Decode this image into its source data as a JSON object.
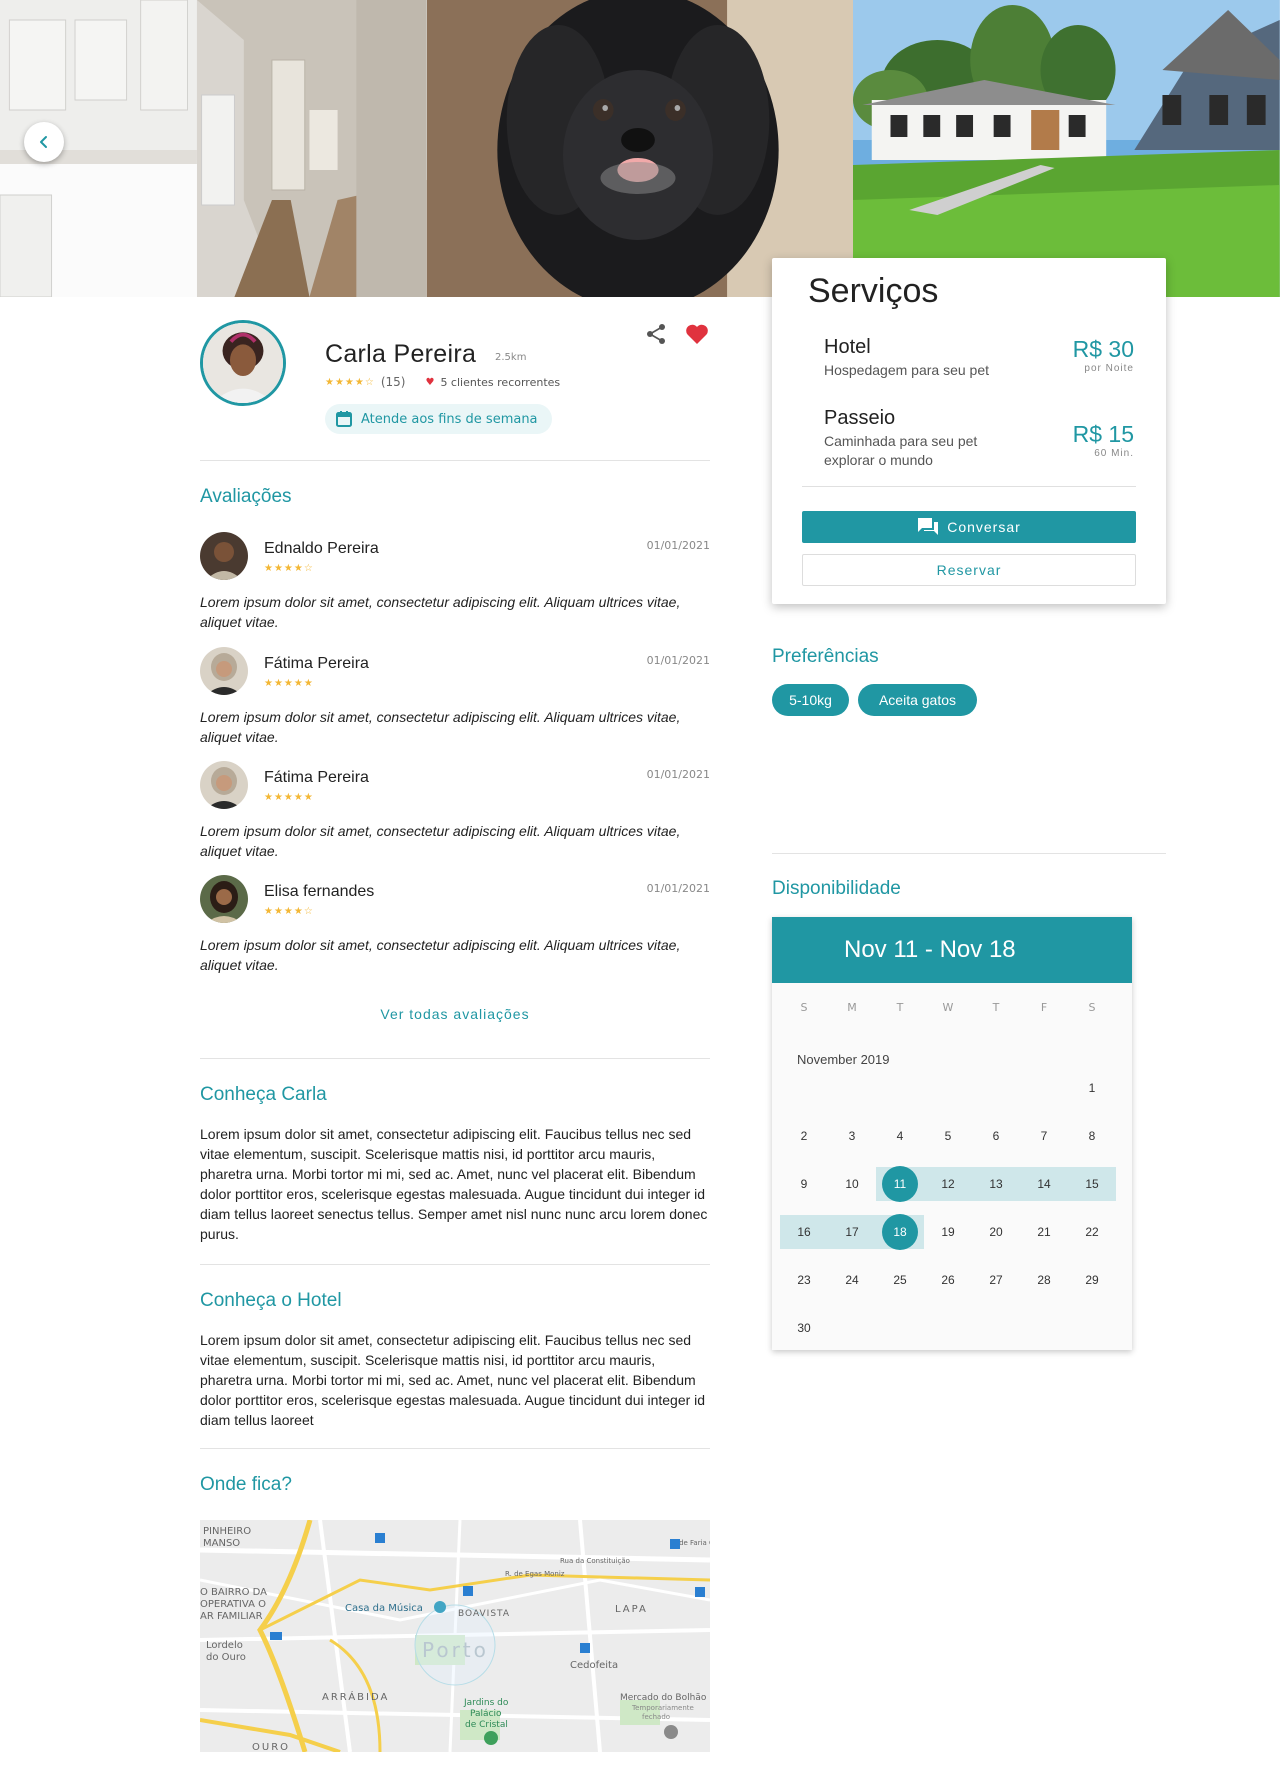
{
  "profile": {
    "name": "Carla Pereira",
    "distance": "2.5km",
    "stars": "★★★★☆",
    "rating_count": "(15)",
    "recurring_clients": "5 clientes recorrentes",
    "weekend_badge": "Atende aos fins de semana"
  },
  "reviews": {
    "title": "Avaliações",
    "see_all": "Ver todas avaliações",
    "items": [
      {
        "name": "Ednaldo Pereira",
        "stars": "★★★★☆",
        "date": "01/01/2021",
        "text": "Lorem ipsum dolor sit amet, consectetur adipiscing elit. Aliquam ultrices vitae, aliquet vitae."
      },
      {
        "name": "Fátima Pereira",
        "stars": "★★★★★",
        "date": "01/01/2021",
        "text": "Lorem ipsum dolor sit amet, consectetur adipiscing elit. Aliquam ultrices vitae, aliquet vitae."
      },
      {
        "name": "Fátima Pereira",
        "stars": "★★★★★",
        "date": "01/01/2021",
        "text": "Lorem ipsum dolor sit amet, consectetur adipiscing elit. Aliquam ultrices vitae, aliquet vitae."
      },
      {
        "name": "Elisa fernandes",
        "stars": "★★★★☆",
        "date": "01/01/2021",
        "text": "Lorem ipsum dolor sit amet, consectetur adipiscing elit. Aliquam ultrices vitae, aliquet vitae."
      }
    ]
  },
  "about": {
    "title": "Conheça Carla",
    "text": "Lorem ipsum dolor sit amet, consectetur adipiscing elit. Faucibus tellus nec sed vitae elementum, suscipit. Scelerisque mattis nisi, id porttitor arcu mauris, pharetra urna. Morbi tortor mi mi, sed ac. Amet, nunc vel placerat elit. Bibendum dolor porttitor eros, scelerisque egestas malesuada. Augue tincidunt dui integer id diam tellus laoreet senectus tellus. Semper amet nisl nunc nunc arcu lorem donec purus."
  },
  "hotel": {
    "title": "Conheça o Hotel",
    "text": "Lorem ipsum dolor sit amet, consectetur adipiscing elit. Faucibus tellus nec sed vitae elementum, suscipit. Scelerisque mattis nisi, id porttitor arcu mauris, pharetra urna. Morbi tortor mi mi, sed ac. Amet, nunc vel placerat elit. Bibendum dolor porttitor eros, scelerisque egestas malesuada. Augue tincidunt dui integer id diam tellus laoreet"
  },
  "location": {
    "title": "Onde fica?",
    "labels": {
      "pinheiro": "PINHEIRO",
      "manso": "MANSO",
      "bairro1": "O BAIRRO DA",
      "bairro2": "OPERATIVA O",
      "bairro3": "AR FAMILIAR",
      "lordelo1": "Lordelo",
      "lordelo2": "do Ouro",
      "arrabida": "ARRÁBIDA",
      "ouro": "OURO",
      "casa": "Casa da Música",
      "boavista": "BOAVISTA",
      "porto": "Porto",
      "lapa": "LAPA",
      "cedofeita": "Cedofeita",
      "egas": "R. de Egas Moniz",
      "constituicao": "Rua da Constituição",
      "faria": "R. de Faria G.",
      "mercado": "Mercado do Bolhão",
      "temp": "Temporariamente",
      "fechado": "fechado",
      "jardins1": "Jardins do",
      "jardins2": "Palácio",
      "jardins3": "de Cristal"
    }
  },
  "services": {
    "title": "Serviços",
    "items": [
      {
        "name": "Hotel",
        "desc": "Hospedagem para seu pet",
        "price": "R$ 30",
        "unit": "por Noite"
      },
      {
        "name": "Passeio",
        "desc": "Caminhada para seu pet explorar o mundo",
        "price": "R$ 15",
        "unit": "60 Min."
      }
    ],
    "chat_label": "Conversar",
    "book_label": "Reservar"
  },
  "preferences": {
    "title": "Preferências",
    "chips": [
      "5-10kg",
      "Aceita gatos"
    ]
  },
  "availability": {
    "title": "Disponibilidade",
    "range": "Nov 11 - Nov 18",
    "weekdays": [
      "S",
      "M",
      "T",
      "W",
      "T",
      "F",
      "S"
    ],
    "month": "November 2019",
    "days": [
      "1",
      "2",
      "3",
      "4",
      "5",
      "6",
      "7",
      "8",
      "9",
      "10",
      "11",
      "12",
      "13",
      "14",
      "15",
      "16",
      "17",
      "18",
      "19",
      "20",
      "21",
      "22",
      "23",
      "24",
      "25",
      "26",
      "27",
      "28",
      "29",
      "30"
    ],
    "first_weekday": 6,
    "selected_start": 11,
    "selected_end": 18
  },
  "colors": {
    "accent": "#2097a3",
    "range": "#cfe7ea",
    "star": "#f3b735",
    "heart": "#e0323e"
  }
}
